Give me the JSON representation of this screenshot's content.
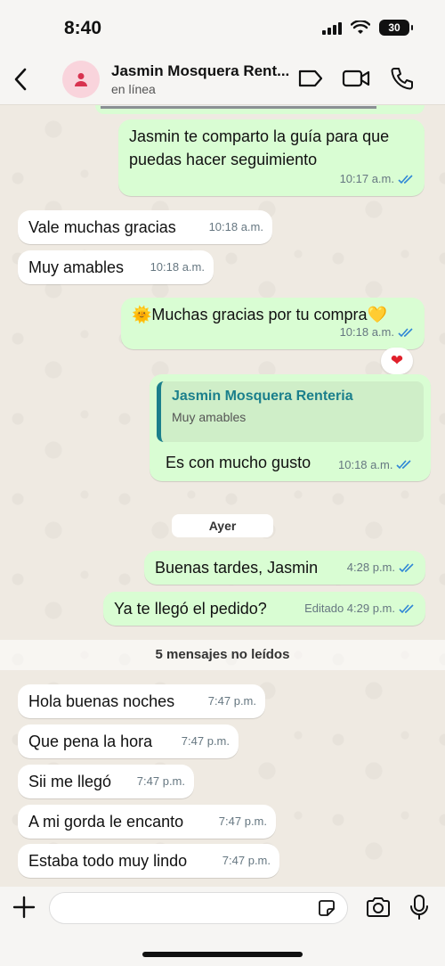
{
  "status_bar": {
    "time": "8:40",
    "battery": "30"
  },
  "header": {
    "contact_name": "Jasmin Mosquera Rent...",
    "contact_status": "en línea"
  },
  "messages": [
    {
      "direction": "out",
      "text": "Jasmin te comparto la guía para que puedas hacer seguimiento",
      "time": "10:17 a.m."
    },
    {
      "direction": "in",
      "text": "Vale muchas gracias",
      "time": "10:18 a.m."
    },
    {
      "direction": "in",
      "text": "Muy amables",
      "time": "10:18 a.m."
    },
    {
      "direction": "out",
      "text": "🌞Muchas gracias por tu compra💛",
      "time": "10:18 a.m.",
      "reaction": "❤"
    },
    {
      "direction": "out",
      "quote_name": "Jasmin Mosquera Renteria",
      "quote_text": "Muy amables",
      "text": "Es con mucho gusto",
      "time": "10:18 a.m."
    },
    {
      "direction": "out",
      "text": "Buenas tardes, Jasmin",
      "time": "4:28 p.m."
    },
    {
      "direction": "out",
      "text": "Ya te llegó el pedido?",
      "time": "Editado 4:29 p.m."
    },
    {
      "direction": "in",
      "text": "Hola buenas noches",
      "time": "7:47 p.m."
    },
    {
      "direction": "in",
      "text": "Que pena la hora",
      "time": "7:47 p.m."
    },
    {
      "direction": "in",
      "text": "Sii me llegó",
      "time": "7:47 p.m."
    },
    {
      "direction": "in",
      "text": "A mi gorda le encanto",
      "time": "7:47 p.m."
    },
    {
      "direction": "in",
      "text": "Estaba todo muy lindo",
      "time": "7:47 p.m."
    }
  ],
  "date_separator": "Ayer",
  "unread_banner": "5 mensajes no leídos",
  "colors": {
    "outgoing": "#d9fdd3",
    "incoming": "#ffffff",
    "tick_blue": "#2f86d6",
    "quote_accent": "#1b7f8c"
  }
}
